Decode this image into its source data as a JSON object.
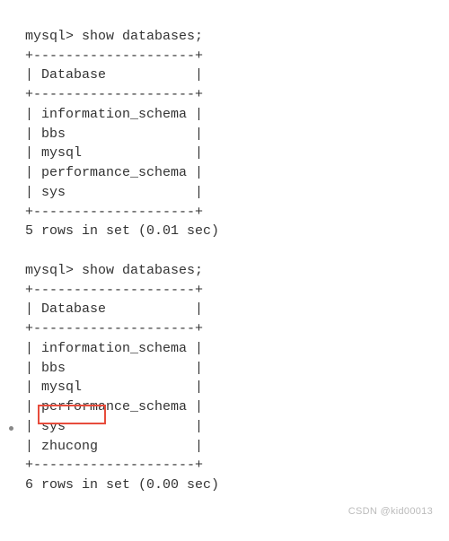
{
  "prompt": "mysql>",
  "command": "show databases;",
  "table": {
    "border": "+--------------------+",
    "header": "| Database           |",
    "rows1": [
      "| information_schema |",
      "| bbs                |",
      "| mysql              |",
      "| performance_schema |",
      "| sys                |"
    ],
    "rows2": [
      "| information_schema |",
      "| bbs                |",
      "| mysql              |",
      "| performance_schema |",
      "| sys                |",
      "| zhucong            |"
    ]
  },
  "result1": "5 rows in set (0.01 sec)",
  "result2": "6 rows in set (0.00 sec)",
  "watermark": "CSDN @kid00013",
  "highlight_text": "zhucong"
}
